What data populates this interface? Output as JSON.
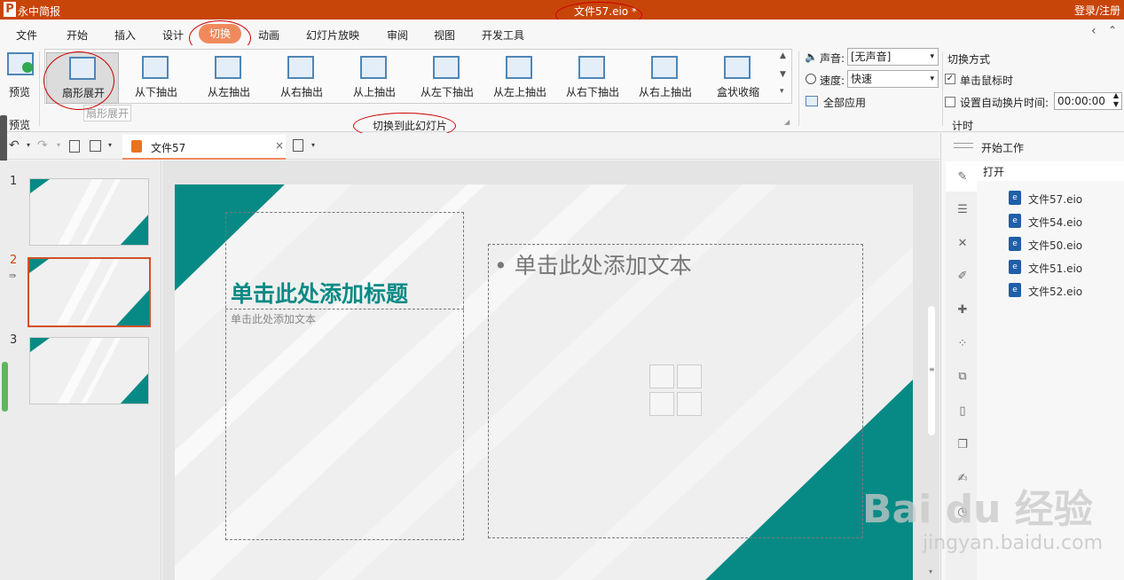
{
  "titlebar": {
    "app_name": "永中简报",
    "doc_title": "文件57.eio *",
    "login": "登录/注册"
  },
  "menu": [
    "文件",
    "开始",
    "插入",
    "设计",
    "切换",
    "动画",
    "幻灯片放映",
    "审阅",
    "视图",
    "开发工具"
  ],
  "ribbon": {
    "preview_label": "预览",
    "preview_group": "预览",
    "transitions": [
      "扇形展开",
      "从下抽出",
      "从左抽出",
      "从右抽出",
      "从上抽出",
      "从左下抽出",
      "从左上抽出",
      "从右下抽出",
      "从右上抽出",
      "盒状收缩"
    ],
    "tooltip": "扇形展开",
    "group_label": "切换到此幻灯片",
    "sound_label": "声音:",
    "sound_value": "[无声音]",
    "speed_label": "速度:",
    "speed_value": "快速",
    "apply_all": "全部应用",
    "switch_mode_label": "切换方式",
    "on_click_label": "单击鼠标时",
    "auto_label": "设置自动换片时间:",
    "auto_time": "00:00:00",
    "timing_label": "计时"
  },
  "quickbar": {
    "tab_label": "文件57"
  },
  "slides": {
    "numbers": [
      "1",
      "2",
      "3"
    ],
    "selected": 2
  },
  "slide": {
    "title_placeholder": "单击此处添加标题",
    "subtitle_placeholder": "单击此处添加文本",
    "content_placeholder": "• 单击此处添加文本"
  },
  "rpanel": {
    "start_work": "开始工作",
    "open": "打开",
    "recent_files": [
      "文件57.eio",
      "文件54.eio",
      "文件50.eio",
      "文件51.eio",
      "文件52.eio"
    ]
  },
  "colors": {
    "titlebar": "#c8450a",
    "teal": "#078a85",
    "accent_pill": "#f08a5d"
  },
  "watermark": {
    "line1": "Bai du 经验",
    "line2": "jingyan.baidu.com"
  }
}
